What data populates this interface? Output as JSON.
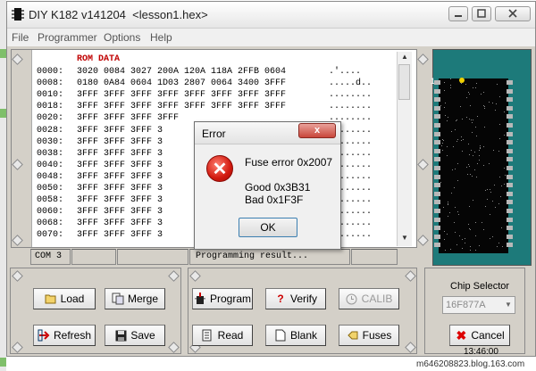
{
  "window": {
    "title": "DIY K182 v141204  <lesson1.hex>",
    "caption_buttons": {
      "minimize": "minimize-icon",
      "maximize": "maximize-icon",
      "close": "close-icon"
    }
  },
  "menu": [
    "File",
    "Programmer",
    "Options",
    "Help"
  ],
  "hex": {
    "header": "ROM DATA",
    "rows": [
      {
        "addr": "0000:",
        "data": "3020 0084 3027 200A 120A 118A 2FFB 0604",
        "ascii": ".'...."
      },
      {
        "addr": "0008:",
        "data": "0180 0A84 0604 1D03 2807 0064 3400 3FFF",
        "ascii": ".....d.."
      },
      {
        "addr": "0010:",
        "data": "3FFF 3FFF 3FFF 3FFF 3FFF 3FFF 3FFF 3FFF",
        "ascii": "........"
      },
      {
        "addr": "0018:",
        "data": "3FFF 3FFF 3FFF 3FFF 3FFF 3FFF 3FFF 3FFF",
        "ascii": "........"
      },
      {
        "addr": "0020:",
        "data": "3FFF 3FFF 3FFF 3FFF",
        "ascii": "........"
      },
      {
        "addr": "0028:",
        "data": "3FFF 3FFF 3FFF 3",
        "ascii": "........"
      },
      {
        "addr": "0030:",
        "data": "3FFF 3FFF 3FFF 3",
        "ascii": "........"
      },
      {
        "addr": "0038:",
        "data": "3FFF 3FFF 3FFF 3",
        "ascii": "........"
      },
      {
        "addr": "0040:",
        "data": "3FFF 3FFF 3FFF 3",
        "ascii": "........"
      },
      {
        "addr": "0048:",
        "data": "3FFF 3FFF 3FFF 3",
        "ascii": "........"
      },
      {
        "addr": "0050:",
        "data": "3FFF 3FFF 3FFF 3",
        "ascii": "........"
      },
      {
        "addr": "0058:",
        "data": "3FFF 3FFF 3FFF 3",
        "ascii": "........"
      },
      {
        "addr": "0060:",
        "data": "3FFF 3FFF 3FFF 3",
        "ascii": "........"
      },
      {
        "addr": "0068:",
        "data": "3FFF 3FFF 3FFF 3",
        "ascii": "........"
      },
      {
        "addr": "0070:",
        "data": "3FFF 3FFF 3FFF 3",
        "ascii": "........"
      }
    ]
  },
  "status": {
    "port": "COM 3",
    "message": "Programming result..."
  },
  "buttons": {
    "load": "Load",
    "merge": "Merge",
    "refresh": "Refresh",
    "save": "Save",
    "program": "Program",
    "verify": "Verify",
    "calib": "CALIB",
    "read": "Read",
    "blank": "Blank",
    "fuses": "Fuses",
    "cancel": "Cancel"
  },
  "chip_selector": {
    "label": "Chip Selector",
    "selected": "16F877A",
    "pin1_marker": "1"
  },
  "clock": "13:46:00",
  "dialog": {
    "title": "Error",
    "close": "x",
    "message": "Fuse error 0x2007\n\nGood 0x3B31\nBad 0x1F3F",
    "ok": "OK"
  },
  "footer": "m646208823.blog.163.com",
  "colors": {
    "chip_panel": "#1d7a7a",
    "error_red": "#d21a0f",
    "rom_header": "#c00000"
  }
}
